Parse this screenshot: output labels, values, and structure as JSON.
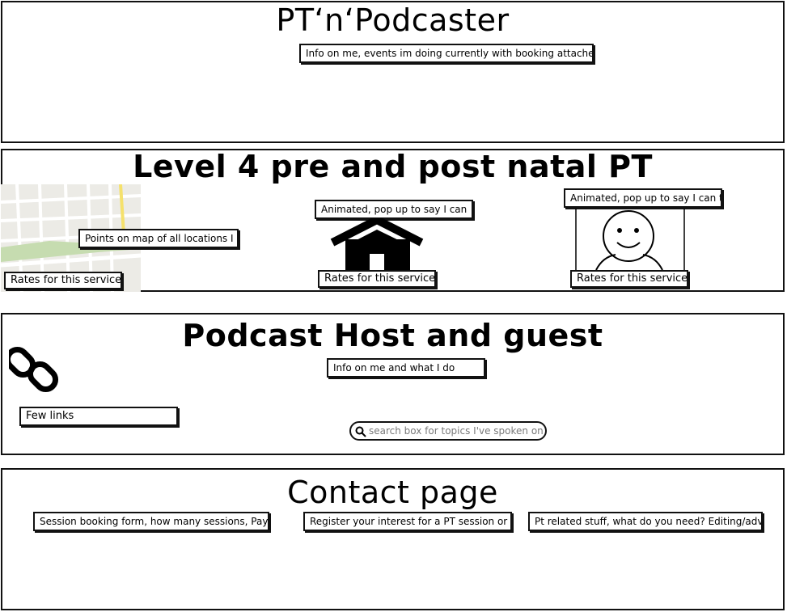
{
  "header": {
    "title": "PT‘n‘Podcaster",
    "info_note": "Info on me, events im doing currently with booking attached"
  },
  "pt_section": {
    "title": "Level 4 pre and post natal PT",
    "map_note": "Points on map of all locations I",
    "map_rates": "Rates for this service",
    "home_note": "Animated, pop up to say I can",
    "home_rates": "Rates for this service",
    "person_note": "Animated, pop up to say I can t",
    "person_rates": "Rates for this service",
    "icons": [
      "map-icon",
      "home-icon",
      "person-icon"
    ]
  },
  "podcast_section": {
    "title": "Podcast Host and guest",
    "info_note": "Info on me and what I do",
    "links_note": "Few links",
    "search_placeholder": "search box for topics I've spoken on",
    "icons": [
      "link-icon",
      "search-icon"
    ]
  },
  "contact_section": {
    "title": "Contact page",
    "booking_note": "Session booking form, how many sessions, Pay",
    "register_note": "Register your interest for a PT session or",
    "pt_stuff_note": "Pt related stuff, what do you need? Editing/advi"
  }
}
